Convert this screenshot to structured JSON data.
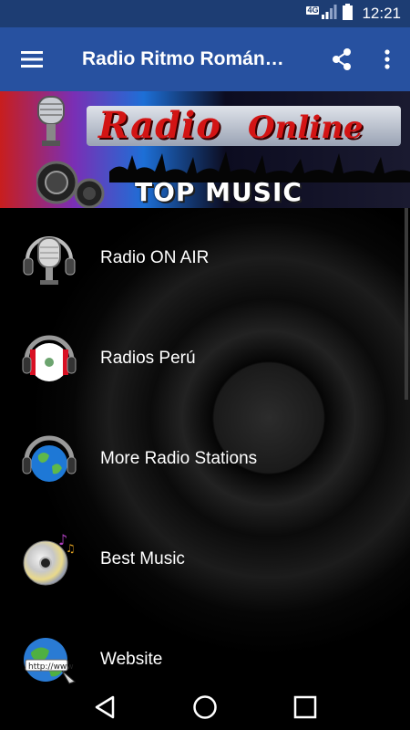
{
  "status_bar": {
    "network": "4G",
    "time": "12:21"
  },
  "app_bar": {
    "title": "Radio Ritmo Román…"
  },
  "banner": {
    "line1_a": "Radio",
    "line1_b": "Online",
    "line2": "TOP MUSIC"
  },
  "menu": {
    "items": [
      {
        "label": "Radio ON AIR",
        "icon": "microphone-headphones-icon"
      },
      {
        "label": "Radios Perú",
        "icon": "peru-flag-headphones-icon"
      },
      {
        "label": "More Radio Stations",
        "icon": "globe-headphones-icon"
      },
      {
        "label": "Best Music",
        "icon": "cd-music-icon"
      },
      {
        "label": "Website",
        "icon": "www-globe-icon"
      }
    ]
  },
  "colors": {
    "status_bar": "#1d3d73",
    "app_bar": "#2751a0",
    "accent_red": "#d31414"
  }
}
